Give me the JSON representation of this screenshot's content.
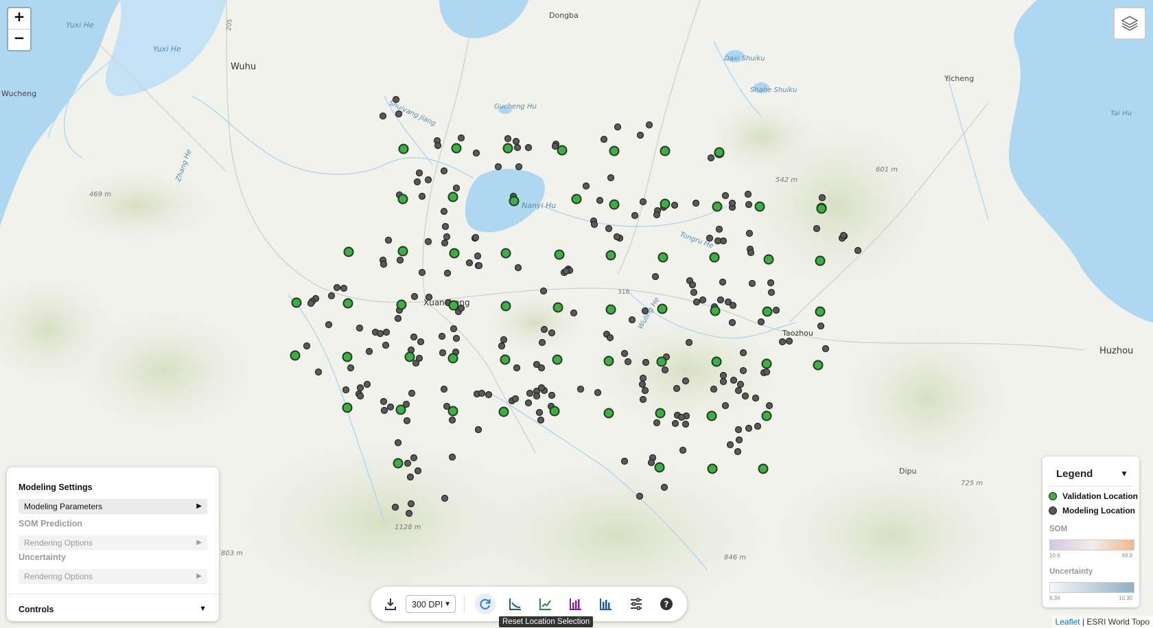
{
  "map": {
    "place_labels": [
      {
        "text": "Dongba"
      },
      {
        "text": "Yuxi He"
      },
      {
        "text": "Yuxi He"
      },
      {
        "text": "Wuhu"
      },
      {
        "text": "Wucheng"
      },
      {
        "text": "Shuiyang Jiang"
      },
      {
        "text": "Gucheng Hu"
      },
      {
        "text": "Daxi Shuiku"
      },
      {
        "text": "Shahe Shuiku"
      },
      {
        "text": "Yicheng"
      },
      {
        "text": "Tai Hu"
      },
      {
        "text": "Zhang He"
      },
      {
        "text": "469 m"
      },
      {
        "text": "Nanyi Hu"
      },
      {
        "text": "542 m"
      },
      {
        "text": "601 m"
      },
      {
        "text": "Tongru He"
      },
      {
        "text": "Xuancheng"
      },
      {
        "text": "318"
      },
      {
        "text": "Wuling He"
      },
      {
        "text": "Taozhou"
      },
      {
        "text": "Huzhou"
      },
      {
        "text": "Dipu"
      },
      {
        "text": "725 m"
      },
      {
        "text": "1128 m"
      },
      {
        "text": "803 m"
      },
      {
        "text": "846 m"
      },
      {
        "text": "205"
      }
    ]
  },
  "zoom": {
    "in_label": "+",
    "out_label": "−"
  },
  "modeling_panel": {
    "title": "Modeling Settings",
    "parameters_label": "Modeling Parameters",
    "som_label": "SOM Prediction",
    "som_rendering_label": "Rendering Options",
    "uncertainty_label": "Uncertainty",
    "uncertainty_rendering_label": "Rendering Options",
    "controls_label": "Controls"
  },
  "legend": {
    "title": "Legend",
    "validation_label": "Validation Location",
    "modeling_label": "Modeling Location",
    "validation_color": "#3cb043",
    "modeling_color": "#5a5a5a",
    "som_label": "SOM",
    "som_min": "10.6",
    "som_max": "49.9",
    "uncertainty_label": "Uncertainty",
    "unc_min": "8.34",
    "unc_max": "10.30"
  },
  "toolbar": {
    "dpi_value": "300 DPI",
    "buttons": [
      "download-icon",
      "refresh-icon",
      "line-chart-icon",
      "trend-chart-icon",
      "bar-chart-purple-icon",
      "bar-chart-blue-icon",
      "sliders-icon",
      "help-icon"
    ],
    "tooltip": "Reset Location Selection"
  },
  "attribution": {
    "leaflet": "Leaflet",
    "separator": "|",
    "source": "ESRI World Topo"
  },
  "points": {
    "validation_count": 61,
    "modeling_count": 271
  }
}
